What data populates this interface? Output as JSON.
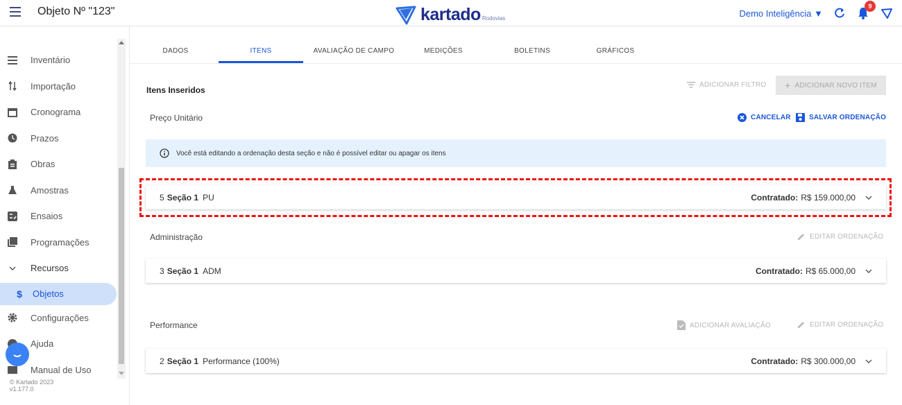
{
  "header": {
    "title": "Objeto Nº \"123\"",
    "logo_text": "kartado",
    "logo_sub": "Rodovias",
    "org": "Demo Inteligência ▼",
    "notification_count": "9",
    "accent": "#1a56db"
  },
  "sidebar": {
    "items": [
      {
        "label": "Inventário",
        "icon": "list-icon"
      },
      {
        "label": "Importação",
        "icon": "import-arrows-icon"
      },
      {
        "label": "Cronograma",
        "icon": "calendar-icon"
      },
      {
        "label": "Prazos",
        "icon": "clock-icon"
      },
      {
        "label": "Obras",
        "icon": "clipboard-icon"
      },
      {
        "label": "Amostras",
        "icon": "flask-icon"
      },
      {
        "label": "Ensaios",
        "icon": "checklist-icon"
      },
      {
        "label": "Programações",
        "icon": "book-icon"
      },
      {
        "label": "Recursos",
        "icon": "chevron-down-icon"
      },
      {
        "label": "Objetos",
        "icon": "dollar-icon"
      },
      {
        "label": "Configurações",
        "icon": "gear-icon"
      },
      {
        "label": "Ajuda",
        "icon": "help-icon"
      },
      {
        "label": "Manual de Uso",
        "icon": "manual-icon"
      }
    ],
    "copyright": "© Kartado 2023",
    "version": "v1.177.0"
  },
  "tabs": [
    "DADOS",
    "ITENS",
    "AVALIAÇÃO DE CAMPO",
    "MEDIÇÕES",
    "BOLETINS",
    "GRÁFICOS"
  ],
  "main": {
    "section_title": "Itens Inseridos",
    "add_filter": "ADICIONAR FILTRO",
    "add_item": "ADICIONAR NOVO ITEM",
    "info": "Você está editando a ordenação desta seção e não é possível editar ou apagar os itens",
    "groups": [
      {
        "label": "Preço Unitário",
        "cancel": "CANCELAR",
        "save": "SALVAR ORDENAÇÃO",
        "item": {
          "num": "5",
          "section": "Seção 1",
          "name": "PU",
          "contract_label": "Contratado:",
          "value": "R$ 159.000,00"
        }
      },
      {
        "label": "Administração",
        "edit": "EDITAR ORDENAÇÃO",
        "item": {
          "num": "3",
          "section": "Seção 1",
          "name": "ADM",
          "contract_label": "Contratado:",
          "value": "R$ 65.000,00"
        }
      },
      {
        "label": "Performance",
        "add_eval": "ADICIONAR AVALIAÇÃO",
        "edit": "EDITAR ORDENAÇÃO",
        "item": {
          "num": "2",
          "section": "Seção 1",
          "name": "Performance (100%)",
          "contract_label": "Contratado:",
          "value": "R$ 300.000,00"
        }
      }
    ]
  }
}
